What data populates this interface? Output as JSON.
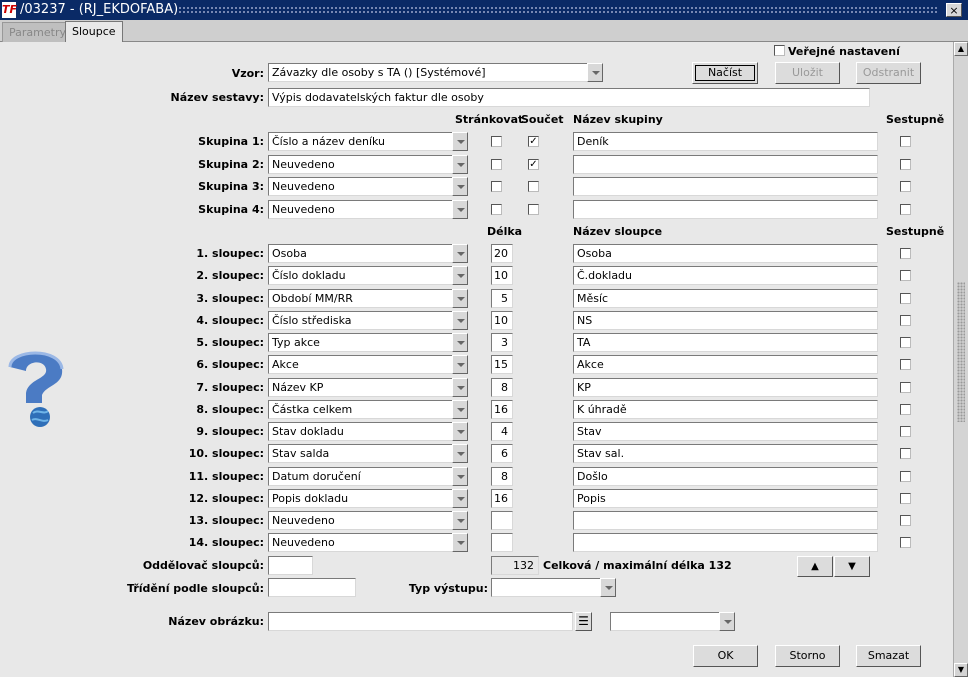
{
  "window": {
    "title": "/03237 - (RJ_EKDOFABA)",
    "logo": "TF",
    "close": "×"
  },
  "tabs": [
    "Parametry",
    "Sloupce"
  ],
  "form": {
    "public_label": "Veřejné nastavení",
    "vzor_label": "Vzor:",
    "vzor_value": "Závazky dle osoby s TA   ()   [Systémové]",
    "btn_load": "Načíst",
    "btn_save": "Uložit",
    "btn_remove": "Odstranit",
    "nazev_label": "Název sestavy:",
    "nazev_value": "Výpis dodavatelských faktur dle osoby",
    "hdr_strankovat": "Stránkovat",
    "hdr_soucet": "Součet",
    "hdr_nazev_skupiny": "Název skupiny",
    "hdr_sestupne1": "Sestupně",
    "groups": [
      {
        "label": "Skupina 1:",
        "value": "Číslo a název deníku",
        "strankovat": false,
        "soucet": true,
        "name": "Deník",
        "sestupne": false
      },
      {
        "label": "Skupina 2:",
        "value": "Neuvedeno",
        "strankovat": false,
        "soucet": true,
        "name": "",
        "sestupne": false
      },
      {
        "label": "Skupina 3:",
        "value": "Neuvedeno",
        "strankovat": false,
        "soucet": false,
        "name": "",
        "sestupne": false
      },
      {
        "label": "Skupina 4:",
        "value": "Neuvedeno",
        "strankovat": false,
        "soucet": false,
        "name": "",
        "sestupne": false
      }
    ],
    "hdr_delka": "Délka",
    "hdr_nazev_sloupce": "Název sloupce",
    "hdr_sestupne2": "Sestupně",
    "columns": [
      {
        "label": "1. sloupec:",
        "value": "Osoba",
        "len": "20",
        "name": "Osoba"
      },
      {
        "label": "2. sloupec:",
        "value": "Číslo dokladu",
        "len": "10",
        "name": "Č.dokladu"
      },
      {
        "label": "3. sloupec:",
        "value": "Období MM/RR",
        "len": "5",
        "name": "Měsíc"
      },
      {
        "label": "4. sloupec:",
        "value": "Číslo střediska",
        "len": "10",
        "name": "NS"
      },
      {
        "label": "5. sloupec:",
        "value": "Typ akce",
        "len": "3",
        "name": "TA"
      },
      {
        "label": "6. sloupec:",
        "value": "Akce",
        "len": "15",
        "name": "Akce"
      },
      {
        "label": "7. sloupec:",
        "value": "Název KP",
        "len": "8",
        "name": "KP"
      },
      {
        "label": "8. sloupec:",
        "value": "Částka celkem",
        "len": "16",
        "name": "K úhradě"
      },
      {
        "label": "9. sloupec:",
        "value": "Stav dokladu",
        "len": "4",
        "name": "Stav"
      },
      {
        "label": "10. sloupec:",
        "value": "Stav salda",
        "len": "6",
        "name": "Stav sal."
      },
      {
        "label": "11. sloupec:",
        "value": "Datum doručení",
        "len": "8",
        "name": "Došlo"
      },
      {
        "label": "12. sloupec:",
        "value": "Popis dokladu",
        "len": "16",
        "name": "Popis"
      },
      {
        "label": "13. sloupec:",
        "value": "Neuvedeno",
        "len": "",
        "name": ""
      },
      {
        "label": "14. sloupec:",
        "value": "Neuvedeno",
        "len": "",
        "name": ""
      }
    ],
    "oddelovac_label": "Oddělovač sloupců:",
    "total_len": "132",
    "total_label": "Celková / maximální délka 132",
    "trideni_label": "Třídění podle sloupců:",
    "typ_label": "Typ výstupu:",
    "obrazek_label": "Název obrázku:",
    "btn_ok": "OK",
    "btn_storno": "Storno",
    "btn_smazat": "Smazat"
  },
  "icons": {
    "help": "help-question-globe-icon",
    "up": "arrow-up-icon",
    "down": "arrow-down-icon",
    "list": "list-icon"
  }
}
